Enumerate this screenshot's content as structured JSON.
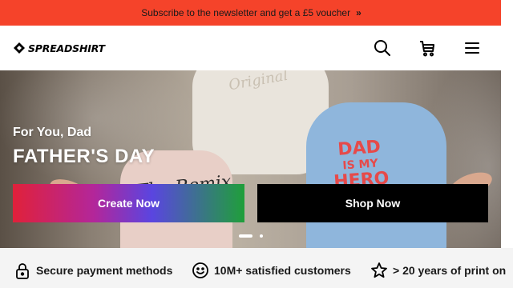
{
  "promo": {
    "text": "Subscribe to the newsletter and get a £5 voucher",
    "chevron": "»",
    "background": "#f5432a"
  },
  "header": {
    "logo_text": "SPREADSHIRT",
    "icons": [
      "search-icon",
      "cart-icon",
      "menu-icon"
    ]
  },
  "hero": {
    "kicker": "For You, Dad",
    "headline": "FATHER'S DAY",
    "tee_left": "The Remix",
    "tee_right_top": "DAD",
    "tee_right_mid": "IS MY",
    "tee_right_bottom": "HERO",
    "tee_adult": "Original",
    "create_label": "Create Now",
    "shop_label": "Shop Now",
    "slides_total": 2,
    "slide_active": 1
  },
  "usp": {
    "items": [
      {
        "label": "Secure payment methods",
        "icon": "lock-icon"
      },
      {
        "label": "10M+ satisfied customers",
        "icon": "smiley-icon"
      },
      {
        "label": "> 20 years of print on",
        "icon": "star-icon"
      }
    ]
  }
}
